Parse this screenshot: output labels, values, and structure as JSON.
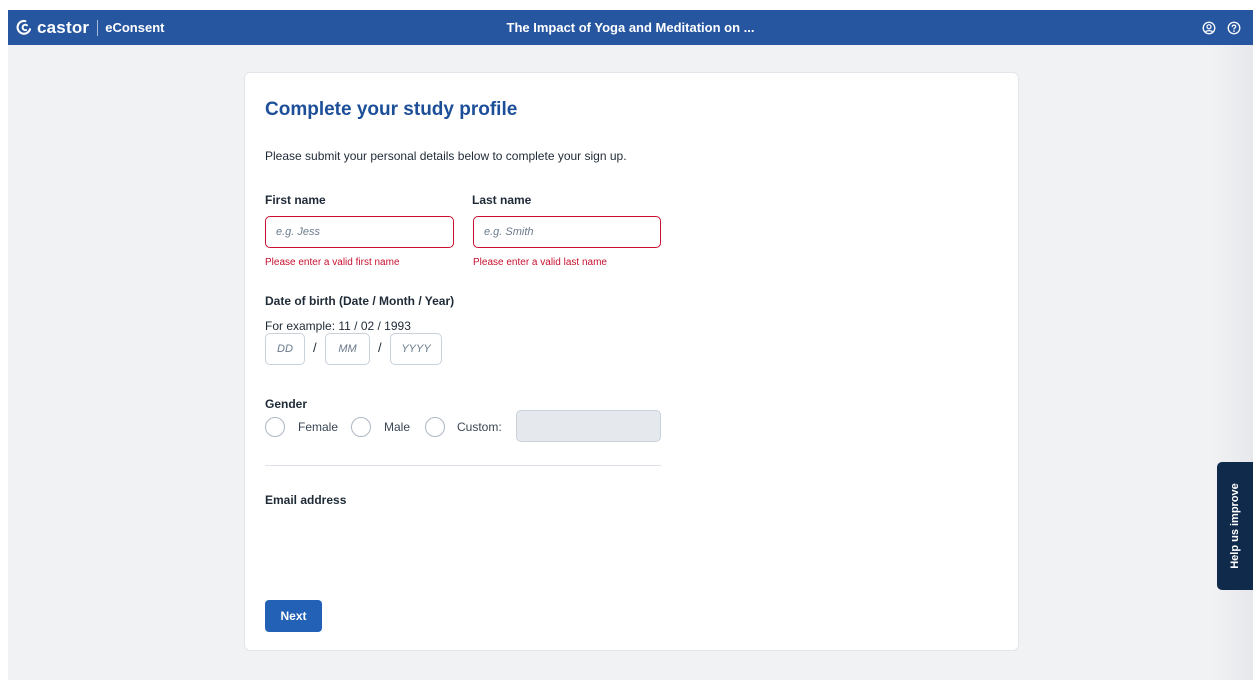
{
  "header": {
    "brand_name": "castor",
    "product": "eConsent",
    "title": "The Impact of Yoga and Meditation on ...",
    "icons": [
      "user-circle-icon",
      "help-circle-icon"
    ],
    "background_color": "#2756a1"
  },
  "form": {
    "title": "Complete your study profile",
    "intro": "Please submit your personal details below to complete your sign up.",
    "first_name": {
      "label": "First name",
      "value": "",
      "placeholder": "e.g. Jess",
      "error": "Please enter a valid first name"
    },
    "last_name": {
      "label": "Last name",
      "value": "",
      "placeholder": "e.g. Smith",
      "error": "Please enter a valid last name"
    },
    "dob": {
      "label": "Date of birth (Date / Month / Year)",
      "example": "For example: 11 / 02 / 1993",
      "day_placeholder": "DD",
      "month_placeholder": "MM",
      "year_placeholder": "YYYY",
      "separator": "/"
    },
    "gender": {
      "label": "Gender",
      "options": [
        "Female",
        "Male",
        "Custom:"
      ],
      "custom_value": ""
    },
    "email": {
      "label": "Email address"
    },
    "next_label": "Next"
  },
  "help_tab": {
    "label": "Help us improve"
  },
  "colors": {
    "primary": "#2261b5",
    "title": "#1d4f99",
    "error": "#c8102e",
    "help_tab": "#102a4c"
  }
}
